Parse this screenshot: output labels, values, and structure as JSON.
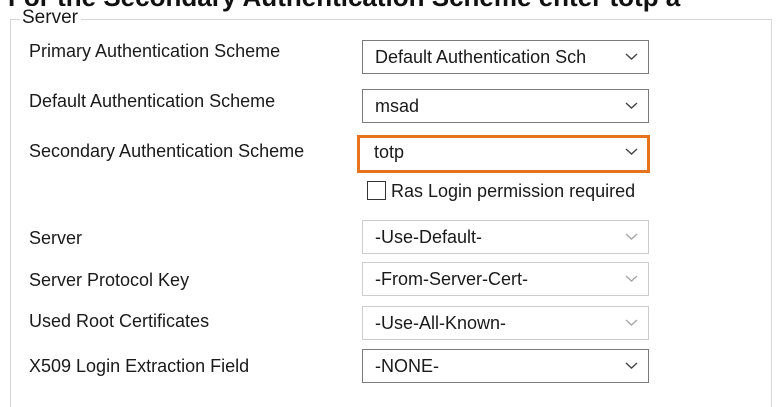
{
  "header": {
    "cut_off_title": "For the Secondary Authentication Scheme enter totp a"
  },
  "group": {
    "title": "Server"
  },
  "fields": {
    "primary_auth": {
      "label": "Primary Authentication Scheme",
      "value": "Default Authentication Sch",
      "enabled": true
    },
    "default_auth": {
      "label": "Default Authentication Scheme",
      "value": "msad",
      "enabled": true
    },
    "secondary_auth": {
      "label": "Secondary Authentication Scheme",
      "value": "totp",
      "enabled": true,
      "highlight_color": "#e8731e"
    },
    "ras_login": {
      "label": "Ras Login permission required",
      "checked": false
    },
    "server": {
      "label": "Server",
      "value": "-Use-Default-",
      "enabled": false
    },
    "server_protocol_key": {
      "label": "Server Protocol Key",
      "value": "-From-Server-Cert-",
      "enabled": false
    },
    "used_root_certificates": {
      "label": "Used Root Certificates",
      "value": "-Use-All-Known-",
      "enabled": false
    },
    "x509_login_extraction": {
      "label": "X509 Login Extraction Field",
      "value": "-NONE-",
      "enabled": true
    }
  },
  "icons": {
    "dropdown_arrow": "chevron-down-icon",
    "checkbox": "checkbox-icon"
  }
}
